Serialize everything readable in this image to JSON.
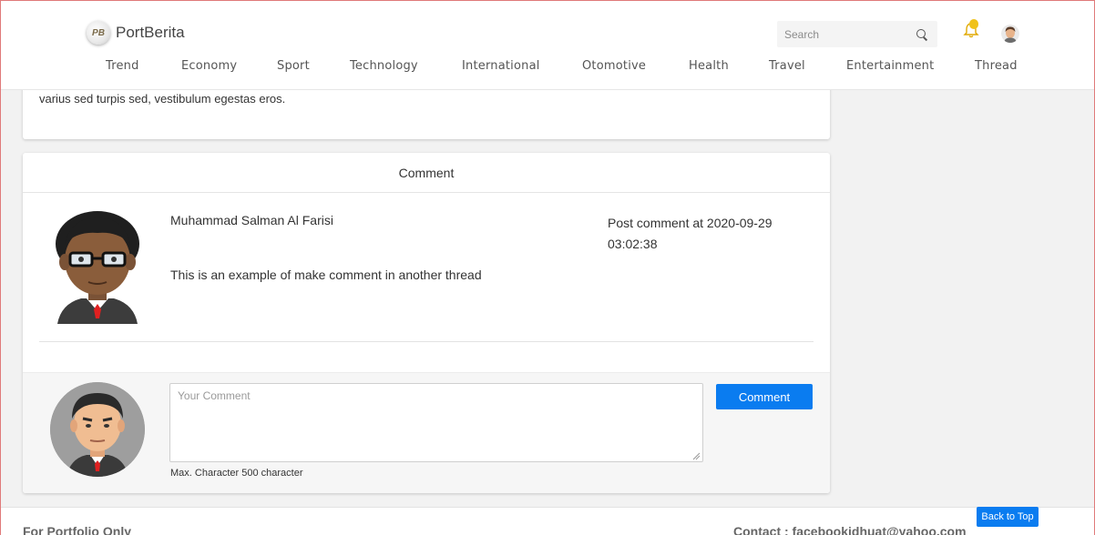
{
  "brand": {
    "name": "PortBerita",
    "logo_text": "PB"
  },
  "search": {
    "placeholder": "Search",
    "value": ""
  },
  "notifications": {
    "badge": ""
  },
  "nav": {
    "items": [
      {
        "label": "Trend"
      },
      {
        "label": "Economy"
      },
      {
        "label": "Sport"
      },
      {
        "label": "Technology"
      },
      {
        "label": "International"
      },
      {
        "label": "Otomotive"
      },
      {
        "label": "Health"
      },
      {
        "label": "Travel"
      },
      {
        "label": "Entertainment"
      },
      {
        "label": "Thread"
      }
    ]
  },
  "article": {
    "tail_text": "varius sed turpis sed, vestibulum egestas eros."
  },
  "comments": {
    "header": "Comment",
    "items": [
      {
        "author": "Muhammad Salman Al Farisi",
        "time": "Post comment at 2020-09-29 03:02:38",
        "body": "This is an example of make comment in another thread"
      }
    ],
    "compose": {
      "placeholder": "Your Comment",
      "value": "",
      "hint": "Max. Character 500 character",
      "button_label": "Comment"
    }
  },
  "footer": {
    "left": "For Portfolio Only",
    "right": "Contact : facebookidhuat@yahoo.com",
    "back_to_top": "Back to Top"
  },
  "colors": {
    "primary": "#0a7cf0",
    "badge": "#f0c21a",
    "page_bg": "#f2f2f2"
  }
}
